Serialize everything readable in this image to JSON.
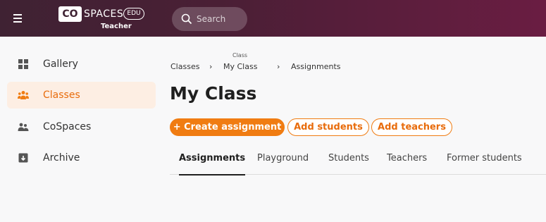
{
  "header": {
    "logo": {
      "co": "CO",
      "spaces": "SPACES",
      "edu": "EDU",
      "subtitle": "Teacher"
    },
    "search": {
      "placeholder": "Search"
    }
  },
  "sidebar": {
    "items": [
      {
        "label": "Gallery",
        "icon": "gallery-grid-icon",
        "active": false
      },
      {
        "label": "Classes",
        "icon": "people-group-icon",
        "active": true
      },
      {
        "label": "CoSpaces",
        "icon": "cospaces-people-icon",
        "active": false
      },
      {
        "label": "Archive",
        "icon": "archive-box-icon",
        "active": false
      }
    ]
  },
  "breadcrumb": {
    "label_above": "Class",
    "items": [
      "Classes",
      "My Class",
      "Assignments"
    ],
    "separator": "›"
  },
  "page": {
    "title": "My Class",
    "actions": {
      "create": "+ Create assignment",
      "add_students": "Add students",
      "add_teachers": "Add teachers"
    },
    "tabs": [
      {
        "label": "Assignments",
        "active": true
      },
      {
        "label": "Playground",
        "active": false
      },
      {
        "label": "Students",
        "active": false
      },
      {
        "label": "Teachers",
        "active": false
      },
      {
        "label": "Former students",
        "active": false
      }
    ]
  },
  "colors": {
    "accent": "#f07c12",
    "header_bg": "#4a1f35",
    "active_item_bg": "#fdeee3"
  }
}
